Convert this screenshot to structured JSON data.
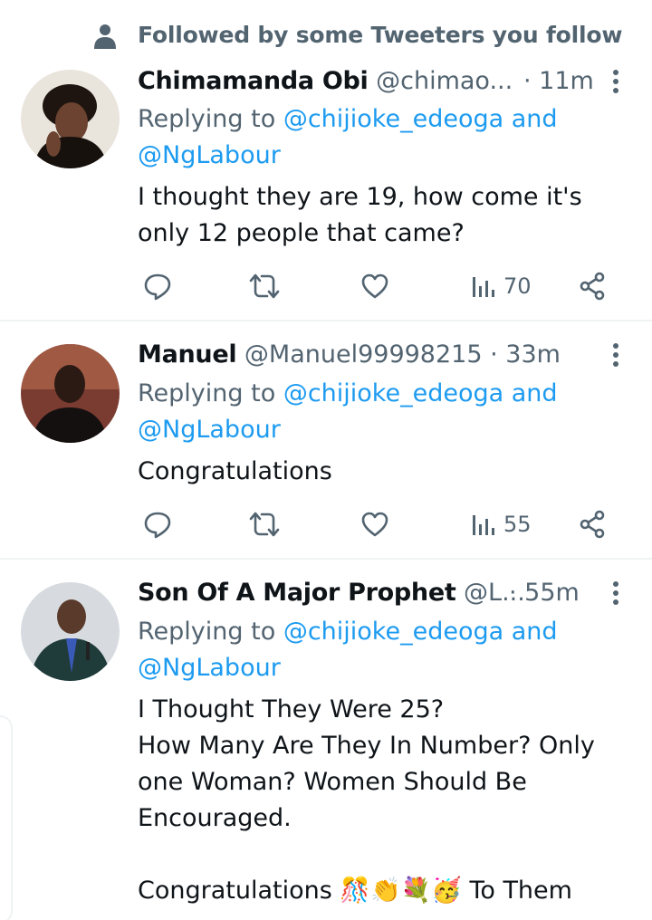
{
  "context": {
    "text": "Followed by some Tweeters you follow",
    "icon": "person-icon"
  },
  "colors": {
    "accent": "#1d9bf0",
    "secondary": "#536471",
    "text": "#0f1419"
  },
  "tweets": [
    {
      "name": "Chimamanda Obi",
      "handle": "@chimao...",
      "time": " · 11m",
      "replying_prefix": "Replying to ",
      "mention1": "@chijioke_edeoga",
      "and": " and",
      "mention2": "@NgLabour",
      "body": "I thought they are 19, how come it's\nonly 12 people that came?",
      "views": "70"
    },
    {
      "name": "Manuel",
      "handle": "@Manuel99998215",
      "time": " · 33m",
      "replying_prefix": "Replying to ",
      "mention1": "@chijioke_edeoga",
      "and": " and",
      "mention2": "@NgLabour",
      "body": "Congratulations",
      "views": "55"
    },
    {
      "name": "Son Of A Major Prophet",
      "handle": "@L...",
      "time": " · 55m",
      "replying_prefix": "Replying to ",
      "mention1": "@chijioke_edeoga",
      "and": " and",
      "mention2": "@NgLabour",
      "body": "I Thought They Were 25?\nHow Many Are They In Number? Only\none Woman? Women Should Be\nEncouraged.\n\nCongratulations 🎊👏💐🥳 To Them"
    }
  ]
}
